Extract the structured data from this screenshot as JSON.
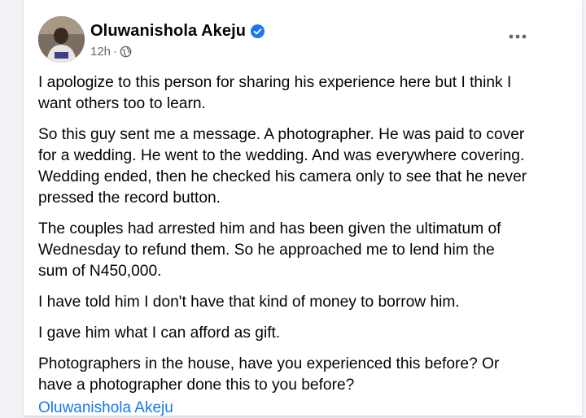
{
  "post": {
    "author_name": "Oluwanishola Akeju",
    "timestamp": "12h",
    "separator": "·",
    "visibility_icon": "globe-icon",
    "verified_icon": "verified-badge-icon",
    "more_icon": "more-options-icon",
    "paragraphs": [
      {
        "lines": [
          "I apologize to this person for sharing his experience here but I think I",
          "want others too to learn."
        ]
      },
      {
        "lines": [
          "So this guy sent me a message. A photographer. He was paid to cover",
          "for a wedding. He went to the wedding. And was everywhere covering.",
          "Wedding ended, then he checked his camera only to see that he never",
          "pressed the record button."
        ]
      },
      {
        "lines": [
          "The couples had arrested him and has been given the ultimatum of",
          "Wednesday to refund them. So he approached me to lend him the",
          "sum of N450,000."
        ]
      },
      {
        "lines": [
          "I have told him I don't have that kind of money to borrow him."
        ]
      },
      {
        "lines": [
          "I gave him what I can afford as gift."
        ]
      },
      {
        "lines": [
          "Photographers in the house, have you experienced this before? Or",
          "have a photographer done this to you before?"
        ]
      }
    ],
    "footer_link": "Oluwanishola Akeju"
  },
  "colors": {
    "link": "#1877f2",
    "verified": "#1877f2",
    "meta_text": "#65676b",
    "background": "#f0f2f5"
  }
}
